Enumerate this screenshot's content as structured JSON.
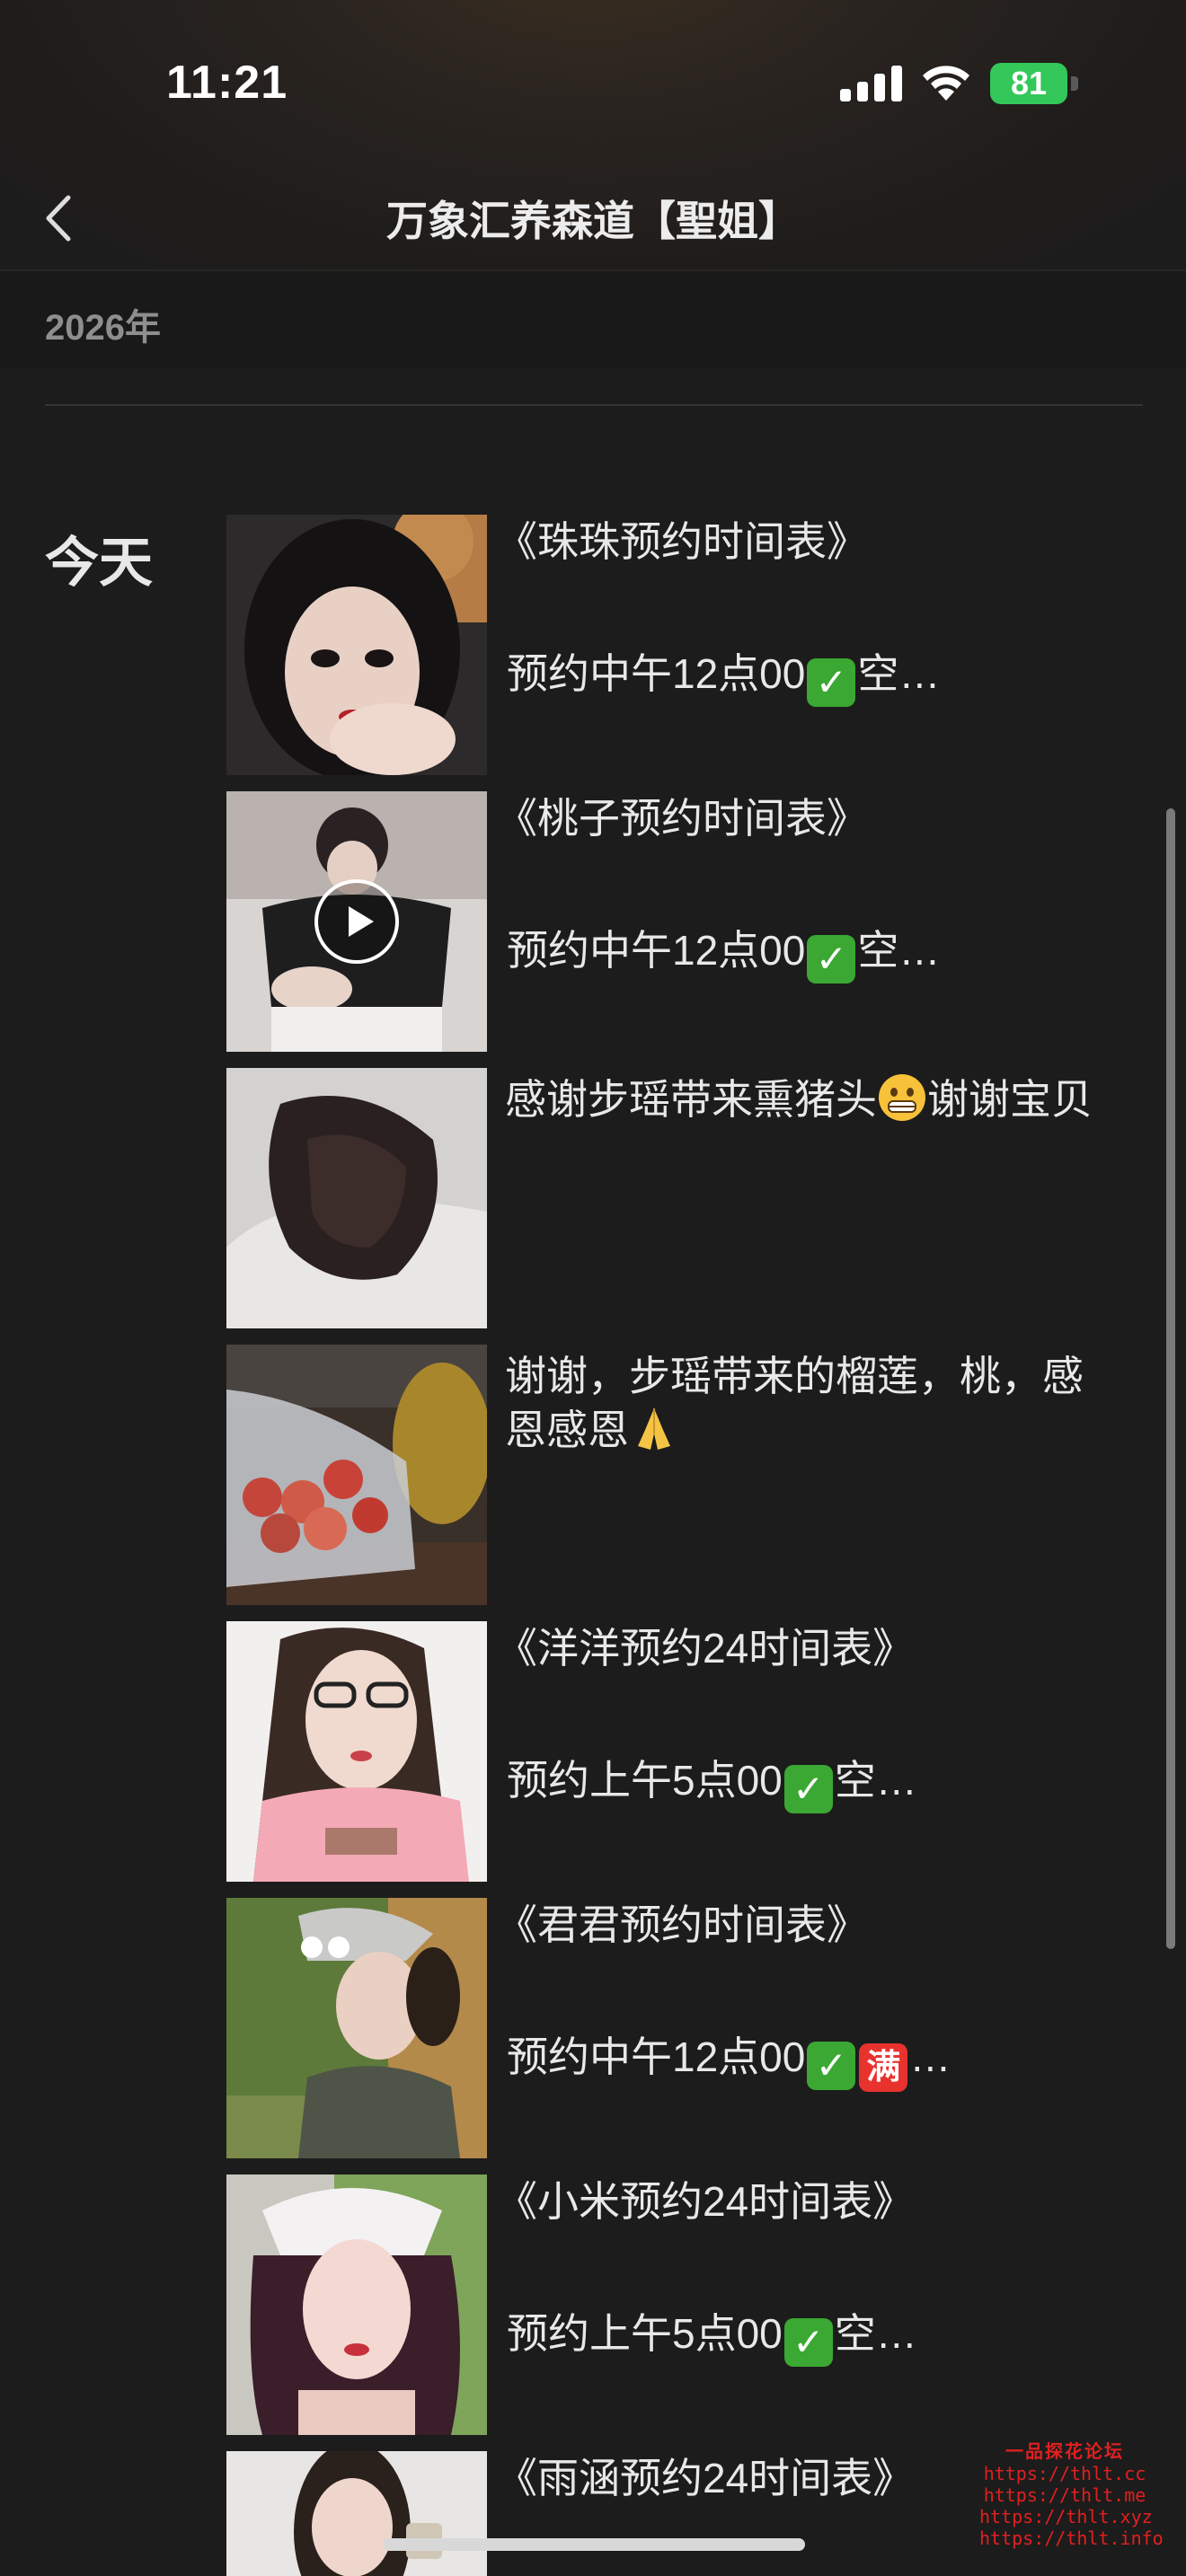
{
  "status_bar": {
    "time": "11:21",
    "battery_percent": "81"
  },
  "nav": {
    "title": "万象汇养森道【聖姐】"
  },
  "year": "2026年",
  "day": "今天",
  "posts": [
    {
      "line1": "《珠珠预约时间表》",
      "line2_pre": "预约中午12点00",
      "line2_post": "空…"
    },
    {
      "line1": "《桃子预约时间表》",
      "line2_pre": "预约中午12点00",
      "line2_post": "空…"
    },
    {
      "text_pre": "感谢步瑶带来熏猪头",
      "text_post": "谢谢宝贝"
    },
    {
      "text_pre": "谢谢，步瑶带来的榴莲，桃，感恩感恩",
      "text_post": ""
    },
    {
      "line1": "《洋洋预约24时间表》",
      "line2_pre": "预约上午5点00",
      "line2_post": "空…"
    },
    {
      "line1": "《君君预约时间表》",
      "line2_pre": "预约中午12点00",
      "line2_mark": "满",
      "line2_post": "…"
    },
    {
      "line1": "《小米预约24时间表》",
      "line2_pre": "预约上午5点00",
      "line2_post": "空…"
    },
    {
      "line1": "《雨涵预约24时间表》"
    }
  ],
  "watermark": {
    "title": "一品探花论坛",
    "lines": [
      "https://thlt.cc",
      "https://thlt.me",
      "https://thlt.xyz",
      "https://thlt.info"
    ]
  },
  "colors": {
    "background": "#1c1c1c",
    "check": "#3aa832",
    "full": "#e8322e",
    "battery": "#34c759",
    "watermark": "#e02020"
  }
}
